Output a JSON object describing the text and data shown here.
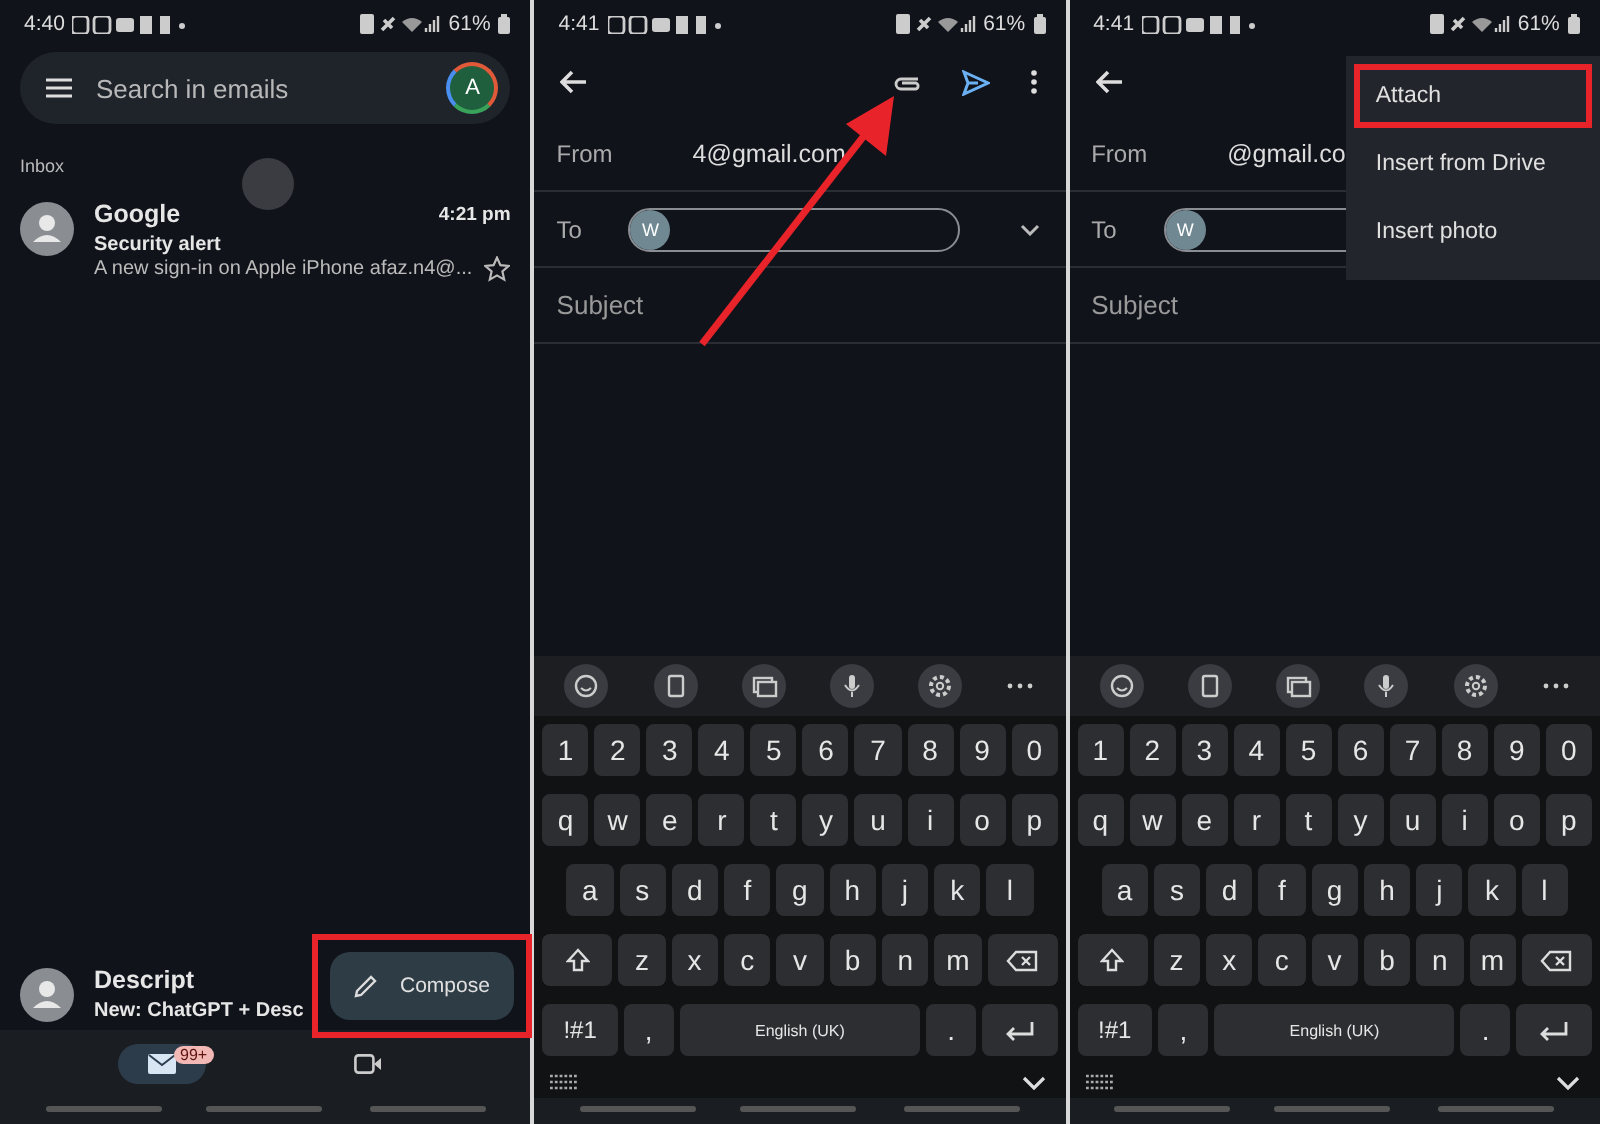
{
  "inbox_screen": {
    "status_time": "4:40",
    "battery": "61%",
    "search_placeholder": "Search in emails",
    "avatar_letter": "A",
    "section": "Inbox",
    "emails": [
      {
        "sender": "Google",
        "time": "4:21 pm",
        "subject": "Security alert",
        "snippet": "A new sign-in on Apple iPhone afaz.n4@...",
        "starred": false
      },
      {
        "sender": "Descript",
        "subject": "New: ChatGPT + Desc"
      }
    ],
    "compose": {
      "label": "Compose",
      "highlighted": true
    },
    "nav": [
      {
        "kind": "mail",
        "badge": "99+",
        "selected": true
      },
      {
        "kind": "meet",
        "selected": false
      }
    ]
  },
  "compose_screen": {
    "status_time": "4:41",
    "battery": "61%",
    "from_label": "From",
    "from_value": "4@gmail.com",
    "to_label": "To",
    "recipient_initial": "W",
    "subject_placeholder": "Subject",
    "keyboard": {
      "rows": [
        [
          "1",
          "2",
          "3",
          "4",
          "5",
          "6",
          "7",
          "8",
          "9",
          "0"
        ],
        [
          "q",
          "w",
          "e",
          "r",
          "t",
          "y",
          "u",
          "i",
          "o",
          "p"
        ],
        [
          "a",
          "s",
          "d",
          "f",
          "g",
          "h",
          "j",
          "k",
          "l"
        ],
        [
          "z",
          "x",
          "c",
          "v",
          "b",
          "n",
          "m"
        ]
      ],
      "symbols": "!#1",
      "comma": ",",
      "space": "English (UK)",
      "period": "."
    }
  },
  "attach_screen": {
    "status_time": "4:41",
    "battery": "61%",
    "from_label": "From",
    "from_value": "@gmail.co",
    "to_label": "To",
    "recipient_initial": "W",
    "subject_placeholder": "Subject",
    "menu": [
      {
        "label": "Attach",
        "highlighted": true
      },
      {
        "label": "Insert from Drive",
        "highlighted": false
      },
      {
        "label": "Insert photo",
        "highlighted": false
      }
    ],
    "keyboard": {
      "rows": [
        [
          "1",
          "2",
          "3",
          "4",
          "5",
          "6",
          "7",
          "8",
          "9",
          "0"
        ],
        [
          "q",
          "w",
          "e",
          "r",
          "t",
          "y",
          "u",
          "i",
          "o",
          "p"
        ],
        [
          "a",
          "s",
          "d",
          "f",
          "g",
          "h",
          "j",
          "k",
          "l"
        ],
        [
          "z",
          "x",
          "c",
          "v",
          "b",
          "n",
          "m"
        ]
      ],
      "symbols": "!#1",
      "comma": ",",
      "space": "English (UK)",
      "period": "."
    }
  }
}
